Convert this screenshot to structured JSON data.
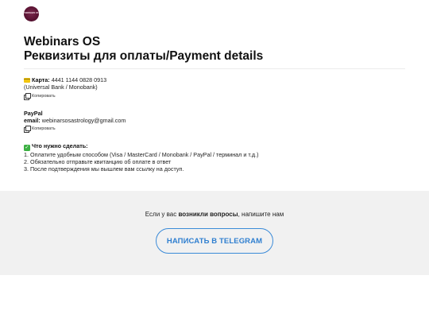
{
  "logo": {
    "text": "WEBINARS OS"
  },
  "header": {
    "title": "Webinars OS",
    "subtitle": "Реквизиты для оплаты/Payment details"
  },
  "card": {
    "label": "Карта:",
    "number": "4441 1144 0828 0913",
    "bank": "(Universal Bank / Monobank)",
    "copy_label": "Копировать"
  },
  "paypal": {
    "title": "PayPal",
    "email_label": "email:",
    "email": "webinarsosastrology@gmail.com",
    "copy_label": "Копировать"
  },
  "todo": {
    "title": "Что нужно сделать:",
    "steps": [
      "1. Оплатите удобным способом (Visa / MasterCard / Monobank / PayPal / терминал и т.д.)",
      "2. Обязательно отправьте квитанцию об оплате в ответ",
      "3. После подтверждения мы вышлем вам ссылку на доступ."
    ]
  },
  "footer": {
    "text_before": "Если у вас",
    "text_bold": "возникли вопросы",
    "text_after": ", напишите нам",
    "button_label": "НАПИСАТЬ В TELEGRAM"
  },
  "colors": {
    "accent": "#3b8bd8",
    "footer_bg": "#f1f1f1",
    "logo_bg": "#5a1232"
  }
}
